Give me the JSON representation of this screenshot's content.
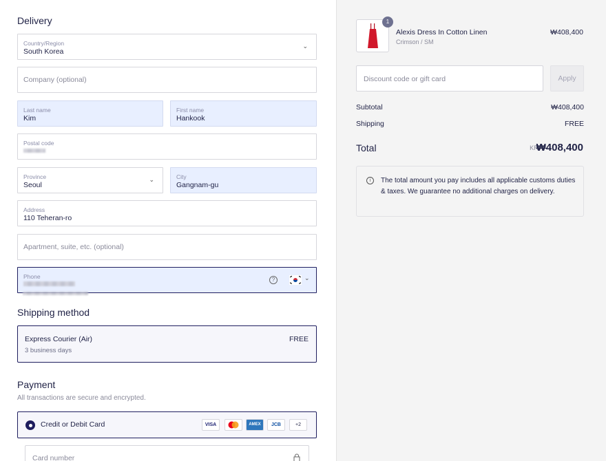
{
  "delivery": {
    "title": "Delivery",
    "country": {
      "label": "Country/Region",
      "value": "South Korea"
    },
    "company": {
      "placeholder": "Company (optional)"
    },
    "last_name": {
      "label": "Last name",
      "value": "Kim"
    },
    "first_name": {
      "label": "First name",
      "value": "Hankook"
    },
    "postal_code": {
      "label": "Postal code"
    },
    "province": {
      "label": "Province",
      "value": "Seoul"
    },
    "city": {
      "label": "City",
      "value": "Gangnam-gu"
    },
    "address": {
      "label": "Address",
      "value": "110 Teheran-ro"
    },
    "apartment": {
      "placeholder": "Apartment, suite, etc. (optional)"
    },
    "phone": {
      "label": "Phone"
    }
  },
  "shipping": {
    "title": "Shipping method",
    "option_name": "Express Courier (Air)",
    "option_days": "3 business days",
    "option_price": "FREE"
  },
  "payment": {
    "title": "Payment",
    "subtitle": "All transactions are secure and encrypted.",
    "method_label": "Credit or Debit Card",
    "cards": [
      "VISA",
      "AMEX",
      "JCB",
      "+2"
    ],
    "card_number_placeholder": "Card number"
  },
  "summary": {
    "product": {
      "qty": "1",
      "name": "Alexis Dress In Cotton Linen",
      "variant": "Crimson / SM",
      "price": "₩408,400"
    },
    "discount_placeholder": "Discount code or gift card",
    "apply_label": "Apply",
    "subtotal_label": "Subtotal",
    "subtotal_value": "₩408,400",
    "shipping_label": "Shipping",
    "shipping_value": "FREE",
    "total_label": "Total",
    "total_currency": "KRW",
    "total_value": "₩408,400",
    "notice": "The total amount you pay includes all applicable customs duties & taxes. We guarantee no additional charges on delivery."
  },
  "colors": {
    "accent": "#1e1d5e",
    "filled_bg": "#e8efff",
    "sidebar_bg": "#f4f4f4"
  }
}
